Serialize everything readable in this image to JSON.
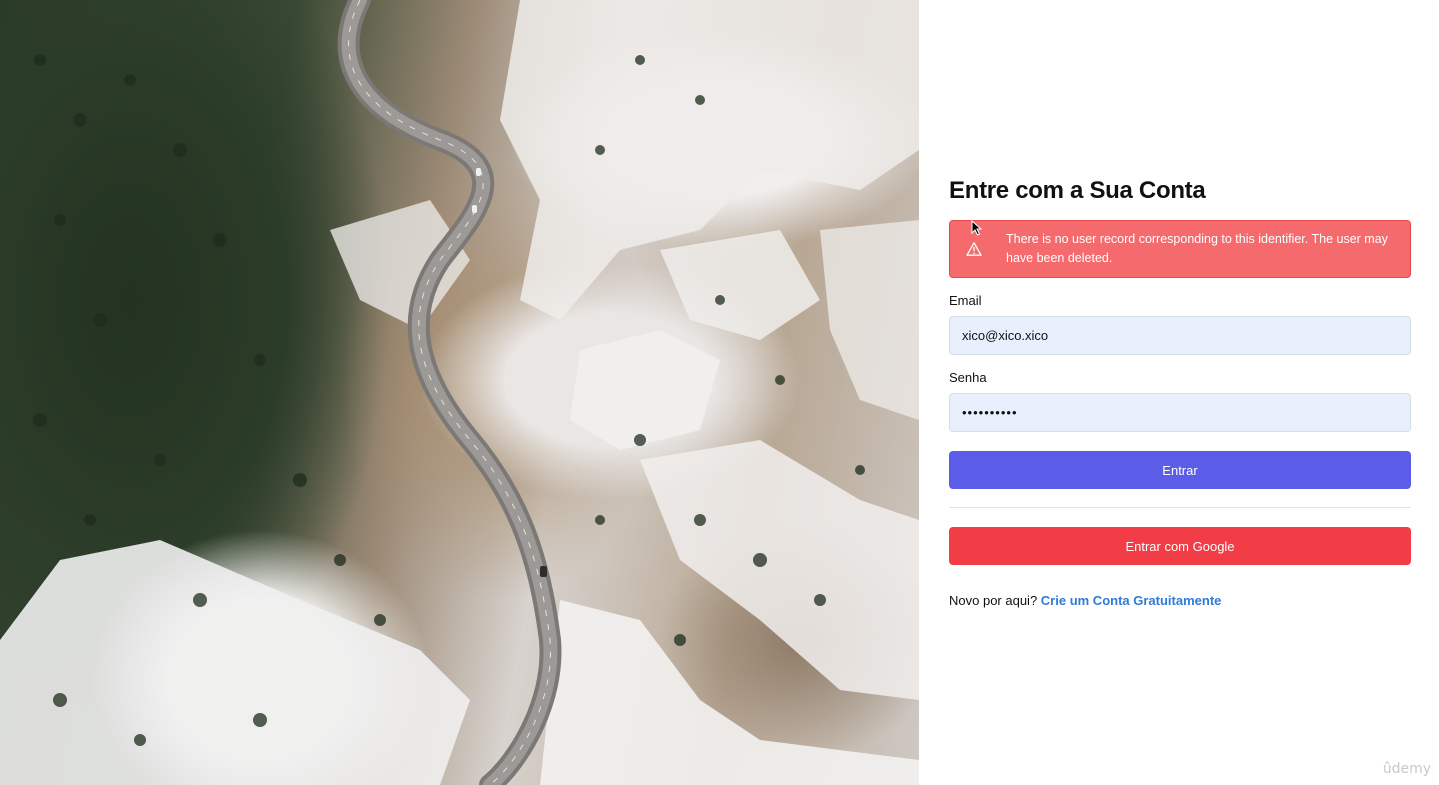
{
  "hero": {
    "alt_icon": "landscape-photo",
    "description_hidden": true
  },
  "login": {
    "title": "Entre com a Sua Conta",
    "alert": {
      "icon": "warning-icon",
      "message": "There is no user record corresponding to this identifier. The user may have been deleted."
    },
    "email": {
      "label": "Email",
      "value": "xico@xico.xico"
    },
    "password": {
      "label": "Senha",
      "value": "••••••••••"
    },
    "submit_label": "Entrar",
    "google_label": "Entrar com Google",
    "signup_prompt": "Novo por aqui?",
    "signup_link": "Crie um Conta Gratuitamente"
  },
  "watermark": "ûdemy",
  "colors": {
    "alert_bg": "#f56a6c",
    "input_bg": "#e8f0fe",
    "primary": "#5b5de8",
    "google": "#f23c46",
    "link": "#2f7bd9"
  }
}
